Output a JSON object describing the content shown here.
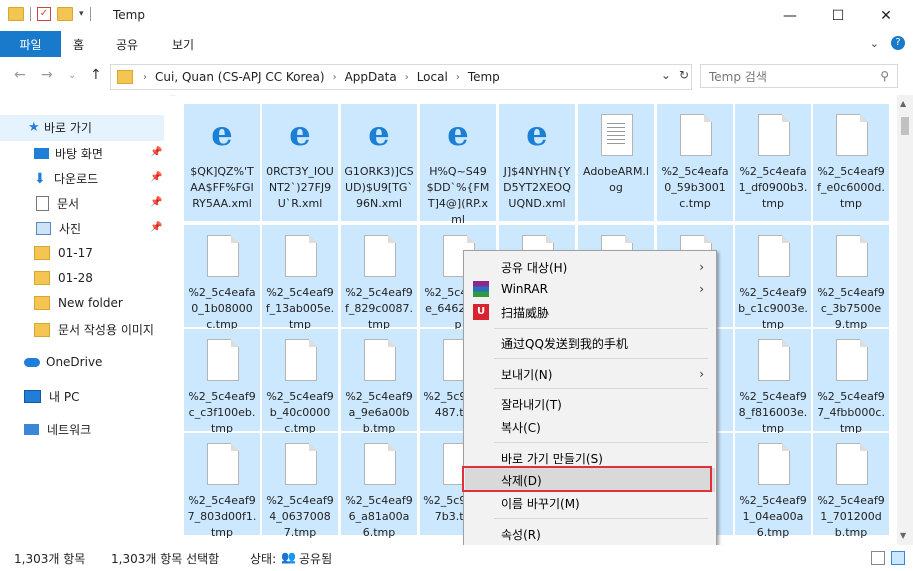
{
  "window": {
    "title": "Temp"
  },
  "ribbon": {
    "tabs": [
      "파일",
      "홈",
      "공유",
      "보기"
    ]
  },
  "address": {
    "crumbs": [
      "Cui, Quan (CS-APJ CC Korea)",
      "AppData",
      "Local",
      "Temp"
    ],
    "search_placeholder": "Temp 검색"
  },
  "sidebar": {
    "quick_access": "바로 가기",
    "items": [
      "바탕 화면",
      "다운로드",
      "문서",
      "사진",
      "01-17",
      "01-28",
      "New folder",
      "문서 작성용 이미지"
    ],
    "onedrive": "OneDrive",
    "pc": "내 PC",
    "network": "네트워크"
  },
  "files": [
    {
      "name": "$QK]QZ%'TAA$FF%FGIRY5AA.xml",
      "icon": "edge-icon"
    },
    {
      "name": "0RCT3Y_IOUNT2`)27FJ9U`R.xml",
      "icon": "edge-icon"
    },
    {
      "name": "G1ORK3)]CSUD)$U9[TG`96N.xml",
      "icon": "edge-icon"
    },
    {
      "name": "H%Q~S49$DD`%{FMT]4@](RP.xml",
      "icon": "edge-icon"
    },
    {
      "name": "J]$4NYHN{YD5YT2XEOQUQND.xml",
      "icon": "edge-icon"
    },
    {
      "name": "AdobeARM.log",
      "icon": "log-file-icon"
    },
    {
      "name": "%2_5c4eafa0_59b3001c.tmp",
      "icon": "file-icon"
    },
    {
      "name": "%2_5c4eafa1_df0900b3.tmp",
      "icon": "file-icon"
    },
    {
      "name": "%2_5c4eaf9f_e0c6000d.tmp",
      "icon": "file-icon"
    },
    {
      "name": "%2_5c4eafa0_1b08000c.tmp",
      "icon": "file-icon"
    },
    {
      "name": "%2_5c4eaf9f_13ab005e.tmp",
      "icon": "file-icon"
    },
    {
      "name": "%2_5c4eaf9f_829c0087.tmp",
      "icon": "file-icon"
    },
    {
      "name": "%2_5c4eaf9e_64624.tmp",
      "icon": "file-icon"
    },
    {
      "name": "",
      "icon": "file-icon"
    },
    {
      "name": "",
      "icon": "file-icon"
    },
    {
      "name": "af f0",
      "icon": "file-icon"
    },
    {
      "name": "%2_5c4eaf9b_c1c9003e.tmp",
      "icon": "file-icon"
    },
    {
      "name": "%2_5c4eaf9c_3b7500e9.tmp",
      "icon": "file-icon"
    },
    {
      "name": "%2_5c4eaf9c_c3f100eb.tmp",
      "icon": "file-icon"
    },
    {
      "name": "%2_5c4eaf9b_40c0000c.tmp",
      "icon": "file-icon"
    },
    {
      "name": "%2_5c4eaf9a_9e6a00bb.tmp",
      "icon": "file-icon"
    },
    {
      "name": "%2_5c99_3a487.tmp",
      "icon": "file-icon"
    },
    {
      "name": "",
      "icon": "file-icon"
    },
    {
      "name": "",
      "icon": "file-icon"
    },
    {
      "name": "af 00 de",
      "icon": "file-icon"
    },
    {
      "name": "%2_5c4eaf98_f816003e.tmp",
      "icon": "file-icon"
    },
    {
      "name": "%2_5c4eaf97_4fbb000c.tmp",
      "icon": "file-icon"
    },
    {
      "name": "%2_5c4eaf97_803d00f1.tmp",
      "icon": "file-icon"
    },
    {
      "name": "%2_5c4eaf94_06370087.tmp",
      "icon": "file-icon"
    },
    {
      "name": "%2_5c4eaf96_a81a00a6.tmp",
      "icon": "file-icon"
    },
    {
      "name": "%2_5c93_827b3.tmp",
      "icon": "file-icon"
    },
    {
      "name": "",
      "icon": "file-icon"
    },
    {
      "name": "",
      "icon": "file-icon"
    },
    {
      "name": "af 00",
      "icon": "file-icon"
    },
    {
      "name": "%2_5c4eaf91_04ea00a6.tmp",
      "icon": "file-icon"
    },
    {
      "name": "%2_5c4eaf91_701200db.tmp",
      "icon": "file-icon"
    }
  ],
  "context_menu": {
    "share_with": "공유 대상(H)",
    "winrar": "WinRAR",
    "scan": "扫描威胁",
    "qq": "通过QQ发送到我的手机",
    "send_to": "보내기(N)",
    "cut": "잘라내기(T)",
    "copy": "복사(C)",
    "shortcut": "바로 가기 만들기(S)",
    "delete": "삭제(D)",
    "rename": "이름 바꾸기(M)",
    "properties": "속성(R)"
  },
  "status": {
    "count": "1,303개 항목",
    "selected": "1,303개 항목 선택함",
    "state_label": "상태:",
    "state_value": "공유됨"
  },
  "colors": {
    "accent": "#1979ca",
    "selection": "#cce8ff",
    "highlight_box": "#e0303a"
  }
}
